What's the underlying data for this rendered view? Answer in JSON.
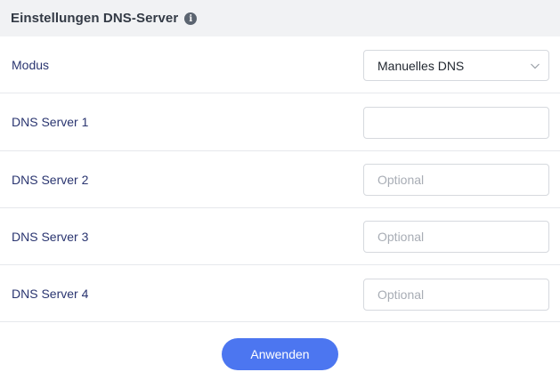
{
  "header": {
    "title": "Einstellungen DNS-Server",
    "info_icon": "info-icon"
  },
  "rows": [
    {
      "label": "Modus",
      "type": "select",
      "value": "Manuelles DNS",
      "placeholder": ""
    },
    {
      "label": "DNS Server 1",
      "type": "input",
      "value": "",
      "placeholder": ""
    },
    {
      "label": "DNS Server 2",
      "type": "input",
      "value": "",
      "placeholder": "Optional"
    },
    {
      "label": "DNS Server 3",
      "type": "input",
      "value": "",
      "placeholder": "Optional"
    },
    {
      "label": "DNS Server 4",
      "type": "input",
      "value": "",
      "placeholder": "Optional"
    }
  ],
  "apply_button": {
    "label": "Anwenden"
  },
  "colors": {
    "accent": "#4c76f0",
    "header_bg": "#f1f2f4",
    "label_text": "#2a3570"
  }
}
